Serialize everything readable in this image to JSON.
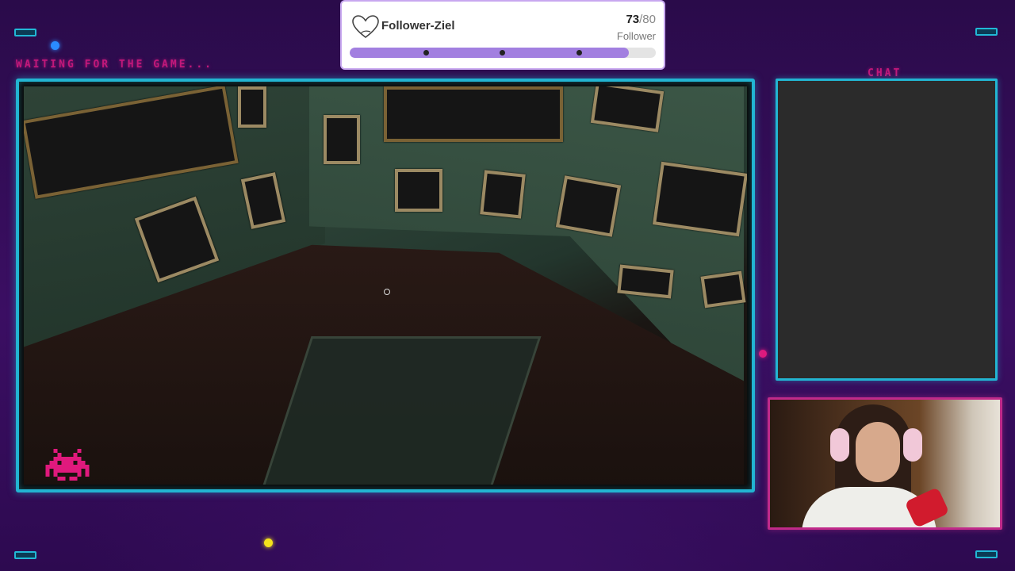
{
  "overlay": {
    "waiting_text": "WAITING FOR THE GAME...",
    "chat_title": "CHAT"
  },
  "follower_goal": {
    "title": "Follower-Ziel",
    "current": "73",
    "target": "/80",
    "unit": "Follower",
    "progress": 0.9125,
    "icon": "heart-icon",
    "accent_color": "#a27fe0"
  },
  "colors": {
    "frame_cyan": "#22b5d2",
    "neon_pink": "#c2187a",
    "background_purple": "#3b0e63"
  }
}
